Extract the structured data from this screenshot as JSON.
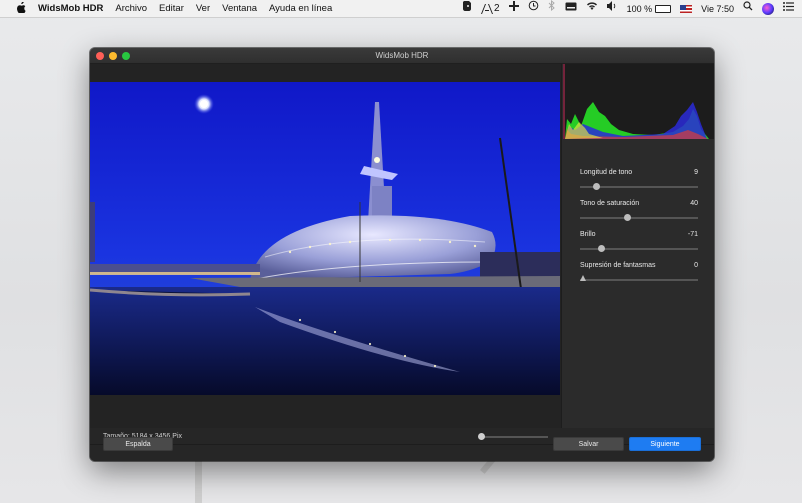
{
  "menubar": {
    "app_name": "WidsMob HDR",
    "items": [
      "Archivo",
      "Editar",
      "Ver",
      "Ventana",
      "Ayuda en línea"
    ],
    "status": {
      "count": "2",
      "battery": "100 %",
      "datetime": "Vie 7:50"
    }
  },
  "window": {
    "title": "WidsMob HDR"
  },
  "image_info": {
    "size_label": "Tamaño: 5184 x 3456 Pix"
  },
  "controls": [
    {
      "label": "Longitud de tono",
      "value": "9",
      "level": 0.12
    },
    {
      "label": "Tono de saturación",
      "value": "40",
      "level": 0.4
    },
    {
      "label": "Brillo",
      "value": "-71",
      "level": 0.16
    },
    {
      "label": "Supresión de fantasmas",
      "value": "0",
      "level": 0.0
    }
  ],
  "buttons": {
    "back": "Espalda",
    "save": "Salvar",
    "next": "Siguiente"
  },
  "colors": {
    "accent": "#1e7cf2",
    "sky": "#1a2bd6",
    "hist_green": "#2ef02e",
    "hist_blue": "#2a2ad8"
  },
  "icons": [
    "apple-icon",
    "evernote-icon",
    "adobe-icon",
    "plus-icon",
    "history-icon",
    "bluetooth-icon",
    "wifi-icon",
    "volume-icon",
    "flag-icon",
    "search-icon",
    "siri-icon",
    "list-icon"
  ]
}
